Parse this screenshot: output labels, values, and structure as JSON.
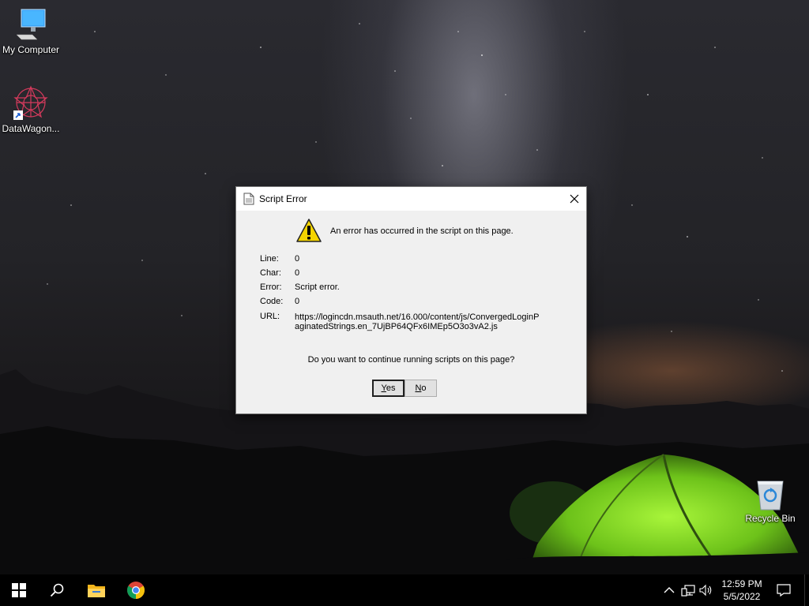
{
  "desktop": {
    "icons": [
      {
        "label": "My Computer",
        "icon": "monitor-icon"
      },
      {
        "label": "DataWagon...",
        "icon": "datawagon-icon"
      },
      {
        "label": "Recycle Bin",
        "icon": "recycle-bin-icon"
      }
    ]
  },
  "dialog": {
    "title": "Script Error",
    "message": "An error has occurred in the script on this page.",
    "details": [
      {
        "label": "Line:",
        "value": "0"
      },
      {
        "label": "Char:",
        "value": "0"
      },
      {
        "label": "Error:",
        "value": "Script error."
      },
      {
        "label": "Code:",
        "value": "0"
      },
      {
        "label": "URL:",
        "value": "https://logincdn.msauth.net/16.000/content/js/ConvergedLoginPaginatedStrings.en_7UjBP64QFx6IMEp5O3o3vA2.js"
      }
    ],
    "question": "Do you want to continue running scripts on this page?",
    "yes_mnemonic": "Y",
    "yes_rest": "es",
    "no_mnemonic": "N",
    "no_rest": "o"
  },
  "taskbar": {
    "time": "12:59 PM",
    "date": "5/5/2022"
  },
  "colors": {
    "taskbar_bg": "#000000",
    "dialog_bg": "#f0f0f0",
    "warning_yellow": "#f5d400"
  }
}
